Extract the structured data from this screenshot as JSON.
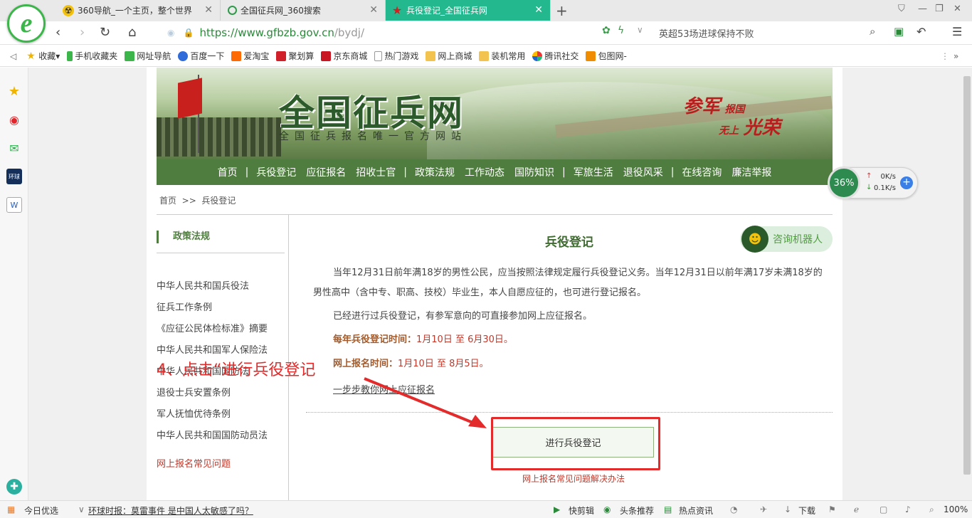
{
  "browser": {
    "tabs": [
      {
        "label": "360导航_一个主页，整个世界",
        "icon": "360-nav-icon"
      },
      {
        "label": "全国征兵网_360搜索",
        "icon": "360-search-icon"
      },
      {
        "label": "兵役登记_全国征兵网",
        "icon": "red-star-icon",
        "active": true
      }
    ],
    "new_tab": "+",
    "url_host": "https://www.gfbzb.gov.cn",
    "url_path": "/bydj/",
    "search_text": "英超53场进球保持不败",
    "bookmarks": [
      "收藏",
      "手机收藏夹",
      "网址导航",
      "百度一下",
      "爱淘宝",
      "聚划算",
      "京东商城",
      "热门游戏",
      "网上商城",
      "装机常用",
      "腾讯社交",
      "包图网-"
    ],
    "status": {
      "left": "今日优选",
      "news": "环球时报：莫雷事件 是中国人太敏感了吗？",
      "items": [
        "快剪辑",
        "头条推荐",
        "热点资讯",
        "下载",
        "100%"
      ]
    },
    "speed": {
      "percent": "36%",
      "up": "0K/s",
      "down": "0.1K/s"
    }
  },
  "site": {
    "title": "全国征兵网",
    "subtitle": "全国征兵报名唯一官方网站",
    "slogan_a": "参军",
    "slogan_a_small": "报国",
    "slogan_b_small": "无上",
    "slogan_b": "光荣",
    "nav": [
      "首页",
      "兵役登记",
      "应征报名",
      "招收士官",
      "政策法规",
      "工作动态",
      "国防知识",
      "军旅生活",
      "退役风采",
      "在线咨询",
      "廉洁举报"
    ],
    "breadcrumb": [
      "首页",
      ">>",
      "兵役登记"
    ]
  },
  "sidebar": {
    "heading": "政策法规",
    "items": [
      "中华人民共和国兵役法",
      "征兵工作条例",
      "《应征公民体检标准》摘要",
      "中华人民共和国军人保险法",
      "中华人民共和国国防法",
      "退役士兵安置条例",
      "军人抚恤优待条例",
      "中华人民共和国国防动员法"
    ],
    "faq": "网上报名常见问题"
  },
  "main": {
    "title": "兵役登记",
    "robot": "咨询机器人",
    "para1": "当年12月31日前年满18岁的男性公民，应当按照法律规定履行兵役登记义务。当年12月31日以前年满17岁未满18岁的男性高中（含中专、职高、技校）毕业生，本人自愿应征的，也可进行登记报名。",
    "para2": "已经进行过兵役登记，有参军意向的可直接参加网上应征报名。",
    "reg_label": "每年兵役登记时间：",
    "reg_time": "1月10日 至 6月30日。",
    "apply_label": "网上报名时间：",
    "apply_time": "1月10日 至 8月5日。",
    "steps_link": "一步步教你网上应征报名",
    "button": "进行兵役登记",
    "faq_link": "网上报名常见问题解决办法"
  },
  "annotation": "4、点击“进行兵役登记",
  "colors": {
    "brand_green": "#4f7d3f",
    "tab_active": "#23b88e",
    "highlight_red": "#e32b2b"
  }
}
